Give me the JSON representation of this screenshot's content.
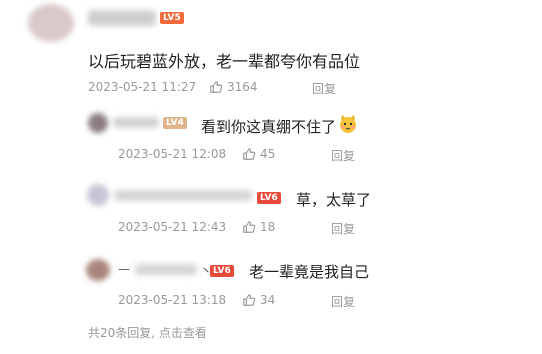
{
  "colors": {
    "level_badge_main": "#f06a3a",
    "level_badge_reply": "#e84a3a",
    "text_primary": "#222222",
    "text_meta": "#999999"
  },
  "main_comment": {
    "level": "LV5",
    "text": "以后玩碧蓝外放，老一辈都夸你有品位",
    "time": "2023-05-21 11:27",
    "likes": "3164",
    "reply_label": "回复"
  },
  "replies": [
    {
      "level": "LV4",
      "text": "看到你这真绷不住了",
      "emoji": "cat-face-emoji",
      "time": "2023-05-21 12:08",
      "likes": "45",
      "reply_label": "回复"
    },
    {
      "level": "LV6",
      "text": "草，太草了",
      "time": "2023-05-21 12:43",
      "likes": "18",
      "reply_label": "回复"
    },
    {
      "level": "LV6",
      "name_suffix": "丶",
      "name_prefix": "—",
      "text": "老一辈竟是我自己",
      "time": "2023-05-21 13:18",
      "likes": "34",
      "reply_label": "回复"
    }
  ],
  "footer": {
    "summary": "共20条回复, 点击查看"
  }
}
